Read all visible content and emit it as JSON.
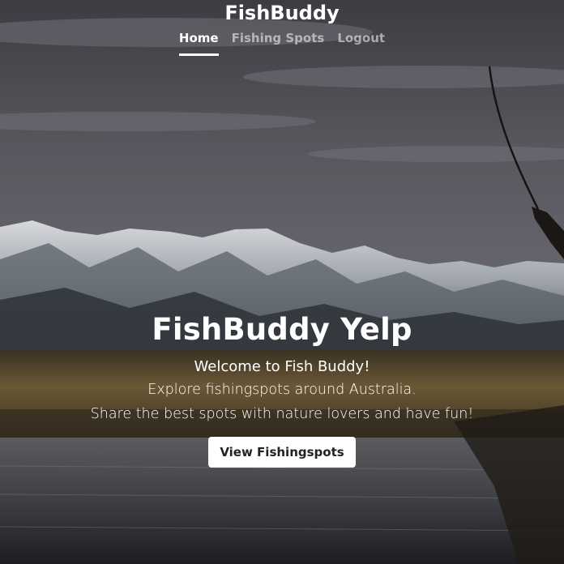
{
  "app": {
    "brand": "FishBuddy"
  },
  "nav": {
    "items": [
      {
        "label": "Home",
        "active": true
      },
      {
        "label": "Fishing Spots",
        "active": false
      },
      {
        "label": "Logout",
        "active": false
      }
    ]
  },
  "hero": {
    "title": "FishBuddy Yelp",
    "subtitle": "Welcome to Fish Buddy!",
    "line1": "Explore fishingspots around Australia.",
    "line2": "Share the best spots with nature lovers and have fun!",
    "button_label": "View Fishingspots"
  },
  "colors": {
    "text": "#ffffff",
    "nav_inactive": "rgba(255,255,255,0.55)",
    "button_bg": "#ffffff",
    "button_text": "#222222"
  }
}
